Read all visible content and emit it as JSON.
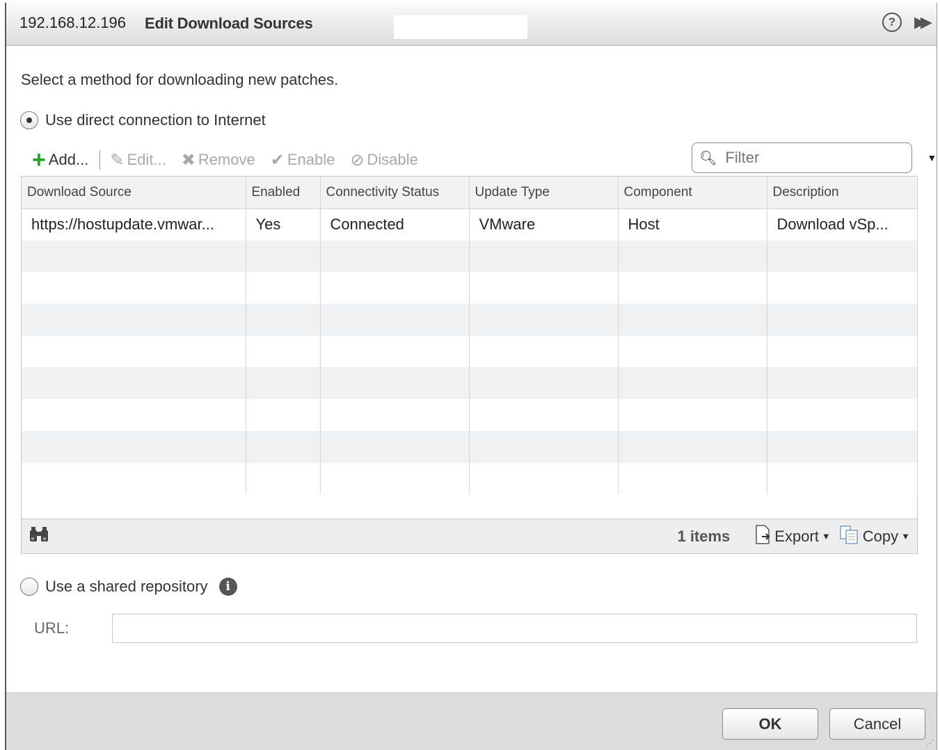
{
  "title": {
    "host": "192.168.12.196",
    "text": "Edit Download Sources"
  },
  "title_buttons": {
    "help_label": "?",
    "expand_label": "▶▶"
  },
  "instructions": "Select a method for downloading new patches.",
  "option_direct": {
    "label": "Use direct connection to Internet",
    "checked": true
  },
  "toolbar": {
    "add": "Add...",
    "edit": "Edit...",
    "remove": "Remove",
    "enable": "Enable",
    "disable": "Disable"
  },
  "filter": {
    "placeholder": "Filter"
  },
  "table": {
    "columns": [
      "Download Source",
      "Enabled",
      "Connectivity Status",
      "Update Type",
      "Component",
      "Description"
    ],
    "rows": [
      [
        "https://hostupdate.vmwar...",
        "Yes",
        "Connected",
        "VMware",
        "Host",
        "Download vSp..."
      ]
    ]
  },
  "grid_footer": {
    "count": "1 items",
    "export": "Export",
    "copy": "Copy"
  },
  "option_shared": {
    "label": "Use a shared repository",
    "checked": false
  },
  "url": {
    "label": "URL:",
    "value": ""
  },
  "buttons": {
    "ok": "OK",
    "cancel": "Cancel"
  },
  "colors": {
    "add_icon": "#2ba22b",
    "title_bar": "#dcdcdc",
    "row_alt": "#eef2f5"
  }
}
